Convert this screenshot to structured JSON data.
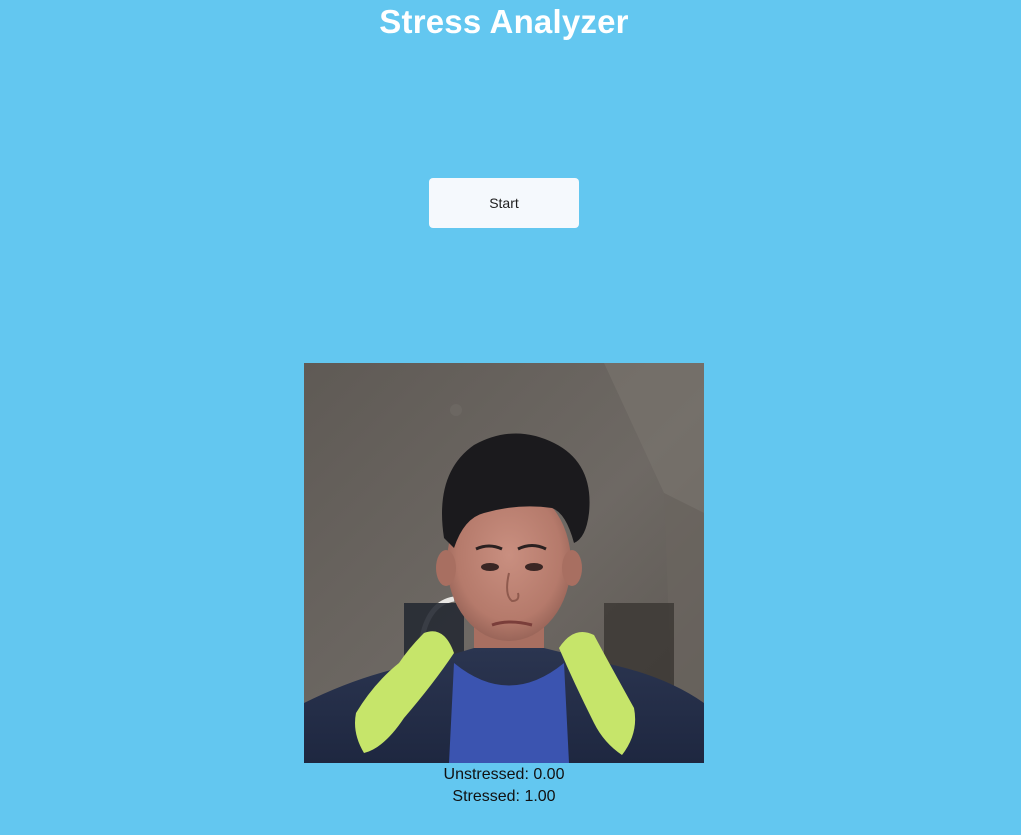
{
  "header": {
    "title": "Stress Analyzer"
  },
  "controls": {
    "start_label": "Start"
  },
  "video": {
    "content": "webcam feed"
  },
  "results": {
    "unstressed_label": "Unstressed",
    "unstressed_value": "0.00",
    "stressed_label": "Stressed",
    "stressed_value": "1.00"
  },
  "colors": {
    "background": "#63c7f0",
    "title": "#ffffff",
    "button_bg": "#f5f9fd"
  }
}
